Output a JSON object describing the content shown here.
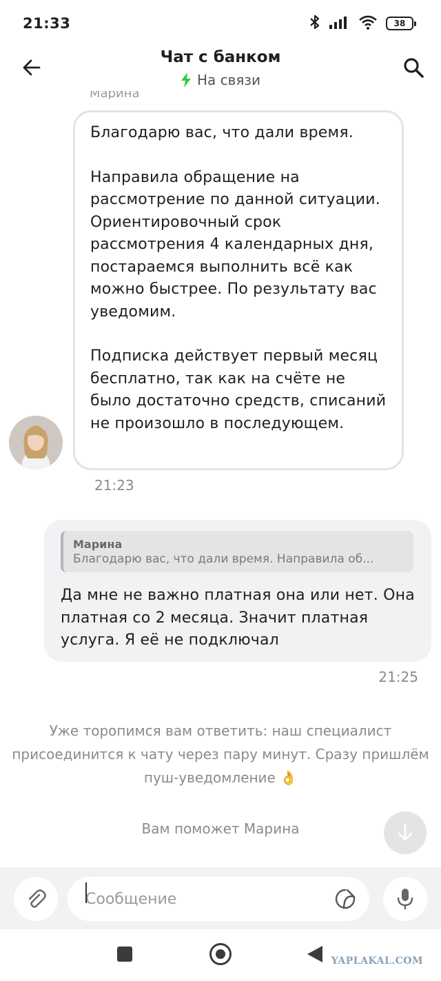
{
  "status_bar": {
    "time": "21:33",
    "battery": "38",
    "icons": [
      "bluetooth-icon",
      "signal-icon",
      "wifi-icon",
      "battery-icon"
    ]
  },
  "header": {
    "title": "Чат с банком",
    "status": "На связи",
    "status_color": "#2ecc40",
    "back_icon": "arrow-left-icon",
    "search_icon": "search-icon"
  },
  "chat": {
    "clipped_sender": "Марина",
    "incoming": {
      "paragraphs": [
        "Благодарю вас, что дали время.",
        "Направила обращение на рассмотрение по данной ситуации. Ориентировочный срок рассмотрения 4 календарных дня, постараемся выполнить всё как можно быстрее. По результату вас уведомим.",
        "Подписка действует первый месяц бесплатно, так как на счёте не было достаточно средств, списаний не произошло в последующем."
      ],
      "time": "21:23"
    },
    "outgoing": {
      "quote_name": "Марина",
      "quote_text": "Благодарю вас, что дали время. Направила об...",
      "text": "Да мне не важно платная она или нет. Она платная со 2 месяца. Значит платная услуга. Я её не подключал",
      "time": "21:25"
    },
    "system_message": "Уже торопимся вам ответить: наш специалист присоединится к чату через пару минут. Сразу пришлём пуш-уведомление 👌",
    "assigned_message": "Вам поможет Марина"
  },
  "composer": {
    "placeholder": "Сообщение",
    "attach_icon": "paperclip-icon",
    "sticker_icon": "sticker-icon",
    "mic_icon": "microphone-icon"
  },
  "nav_bar": {
    "watermark": "YAPLAKAL.COM"
  }
}
